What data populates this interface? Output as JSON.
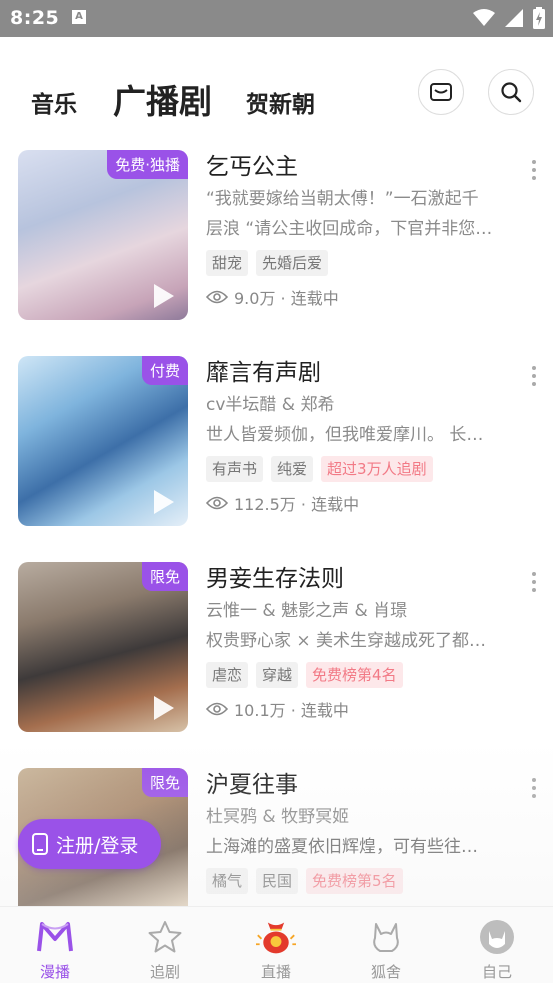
{
  "status_bar": {
    "time": "8:25",
    "notification_icon": "A"
  },
  "header": {
    "tabs": [
      {
        "label": "音乐"
      },
      {
        "label": "广播剧"
      },
      {
        "label": "贺新朝"
      }
    ],
    "mail_icon": "mail-icon",
    "search_icon": "search-icon"
  },
  "items": [
    {
      "title": "乞丐公主",
      "badge": "免费·独播",
      "lines": [
        "“我就要嫁给当朝太傅！”一石激起千",
        "层浪 “请公主收回成命，下官并非您…"
      ],
      "tags": [
        {
          "text": "甜宠",
          "hot": false
        },
        {
          "text": "先婚后爱",
          "hot": false
        }
      ],
      "stats": "9.0万 · 连载中"
    },
    {
      "title": "靡言有声剧",
      "badge": "付费",
      "lines": [
        "cv半坛醋 & 郑希",
        "世人皆爱频伽，但我唯爱摩川。 长…"
      ],
      "tags": [
        {
          "text": "有声书",
          "hot": false
        },
        {
          "text": "纯爱",
          "hot": false
        },
        {
          "text": "超过3万人追剧",
          "hot": true
        }
      ],
      "stats": "112.5万 · 连载中"
    },
    {
      "title": "男妾生存法则",
      "badge": "限免",
      "lines": [
        "云惟一 & 魅影之声 & 肖璟",
        "权贵野心家 × 美术生穿越成死了都…"
      ],
      "tags": [
        {
          "text": "虐恋",
          "hot": false
        },
        {
          "text": "穿越",
          "hot": false
        },
        {
          "text": "免费榜第4名",
          "hot": true
        }
      ],
      "stats": "10.1万 · 连载中"
    },
    {
      "title": "沪夏往事",
      "badge": "限免",
      "lines": [
        "杜冥鸦 & 牧野冥姬",
        "上海滩的盛夏依旧辉煌，可有些往…"
      ],
      "tags": [
        {
          "text": "橘气",
          "hot": false
        },
        {
          "text": "民国",
          "hot": false
        },
        {
          "text": "免费榜第5名",
          "hot": true
        }
      ],
      "stats": ""
    }
  ],
  "login_button": {
    "label": "注册/登录"
  },
  "bottom_nav": [
    {
      "label": "漫播",
      "active": true
    },
    {
      "label": "追剧",
      "active": false
    },
    {
      "label": "直播",
      "active": false
    },
    {
      "label": "狐舍",
      "active": false
    },
    {
      "label": "自己",
      "active": false
    }
  ],
  "colors": {
    "accent": "#9a52e8",
    "hot_tag_text": "#f27a86",
    "hot_tag_bg": "#fde8ea",
    "status_bar": "#8a8a8a"
  }
}
